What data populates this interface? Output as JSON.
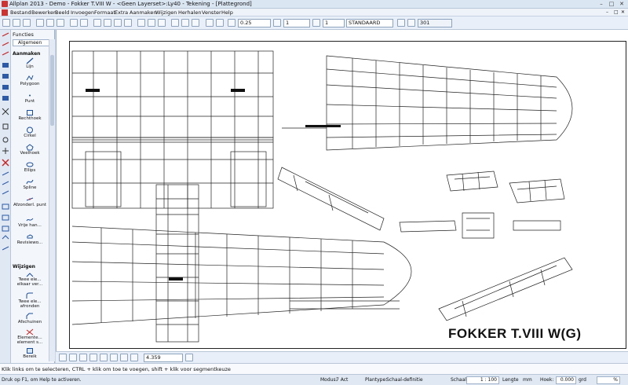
{
  "window": {
    "title": "Allplan 2013 - Demo - Fokker T.VIII W - <Geen Layerset>:Ly40 - Tekening - [Plattegrond]",
    "controls": [
      "–",
      "□",
      "✕"
    ]
  },
  "menu": [
    "Bestand",
    "Bewerken",
    "Beeld",
    "Invoegen",
    "Formaat",
    "Extra",
    "Aanmaken",
    "Wijzigen",
    "Herhalen",
    "Venster",
    "Help"
  ],
  "toolbar": {
    "pen_thickness": "0.25",
    "line_type": "1",
    "color_number": "1",
    "layer": "STANDAARD",
    "hatch": "301"
  },
  "panel": {
    "title": "Functies",
    "tab": "Algemeen",
    "sections": [
      {
        "label": "Aanmaken",
        "items": [
          "Lijn",
          "Polygoon",
          "Punt",
          "Rechthoek",
          "Cirkel",
          "Veelhoek",
          "Ellips",
          "Spline",
          "Afzonderl. punt",
          "Vrije han...",
          "Revisiewo..."
        ]
      },
      {
        "label": "Wijzigen",
        "items": [
          "Twee ele... elkaar ver...",
          "Twee ele... afronden",
          "Afschuinen",
          "Elemente... element s...",
          "Bereik"
        ]
      }
    ]
  },
  "drawing": {
    "title": "FOKKER T.VIII W(G)"
  },
  "bottom_toolbar": {
    "value": "4.359"
  },
  "message": "Klik links om te selecteren, CTRL + klik om toe te voegen, shift + klik voor segmentkeuze",
  "status": {
    "hint": "Druk op F1, om Help te activeren.",
    "modus_label": "Modus:",
    "modus_value": "7 Act",
    "plantype_label": "Plantype:",
    "plantype_value": "Schaal-definitie",
    "schaal_label": "Schaal",
    "schaal_value": "1 : 100",
    "lengte_label": "Lengte",
    "lengte_value": "mm",
    "hoek_label": "Hoek:",
    "hoek_value": "0.000",
    "hoek_unit": "grd",
    "percent": "%"
  },
  "colors": {
    "accent": "#2a5aa8",
    "titlebar": "#dbe6f3",
    "canvas": "#ffffff"
  }
}
